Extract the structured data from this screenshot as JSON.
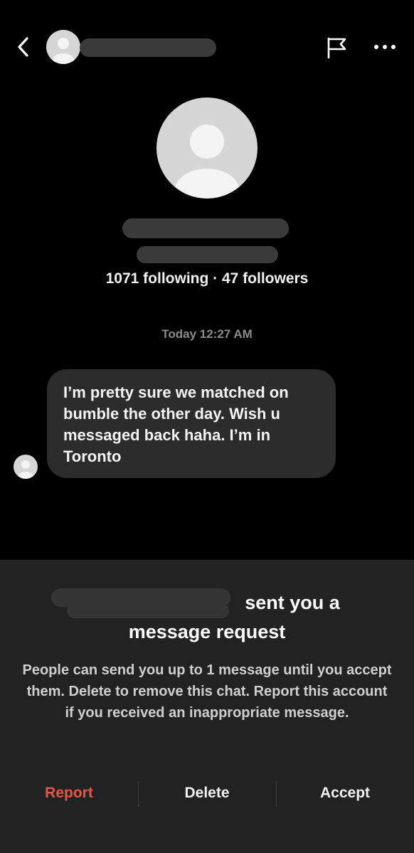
{
  "header": {
    "back_icon": "chevron-left-icon",
    "flag_icon": "flag-icon",
    "more_icon": "more-horizontal-icon"
  },
  "profile": {
    "stats": "1071 following · 47 followers"
  },
  "conversation": {
    "timestamp": "Today 12:27 AM",
    "message": "I’m pretty sure we matched on bumble the other day. Wish u messaged back haha. I’m in Toronto"
  },
  "request_sheet": {
    "title_line1": "sent you a",
    "title_line2": "message request",
    "description": "People can send you up to 1 message until you accept them. Delete to remove this chat. Report this account if you received an inappropriate message.",
    "actions": {
      "report": "Report",
      "delete": "Delete",
      "accept": "Accept"
    },
    "colors": {
      "report": "#e0584a",
      "sheet_background": "#222222"
    }
  }
}
